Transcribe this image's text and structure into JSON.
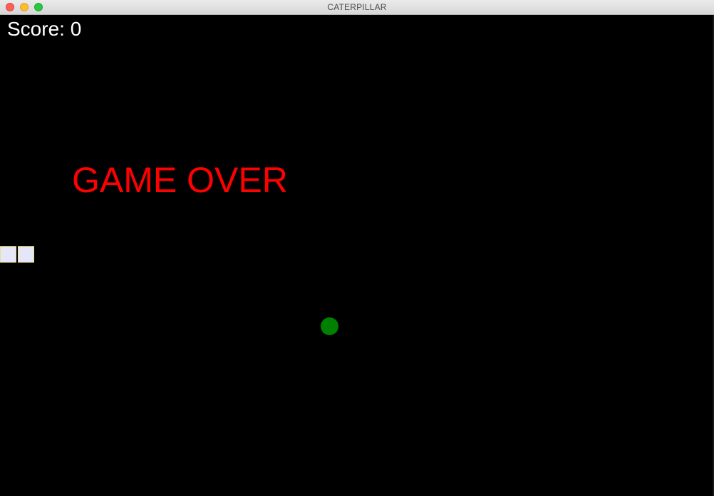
{
  "window": {
    "title": "CATERPILLAR"
  },
  "game": {
    "score_label": "Score: 0",
    "score": 0,
    "status_text": "GAME OVER",
    "caterpillar_segments": 2,
    "colors": {
      "background": "#000000",
      "score_text": "#ffffff",
      "game_over_text": "#ff0000",
      "caterpillar_body": "#e6e6fa",
      "caterpillar_outline": "#e8e08a",
      "food": "#008000"
    }
  }
}
